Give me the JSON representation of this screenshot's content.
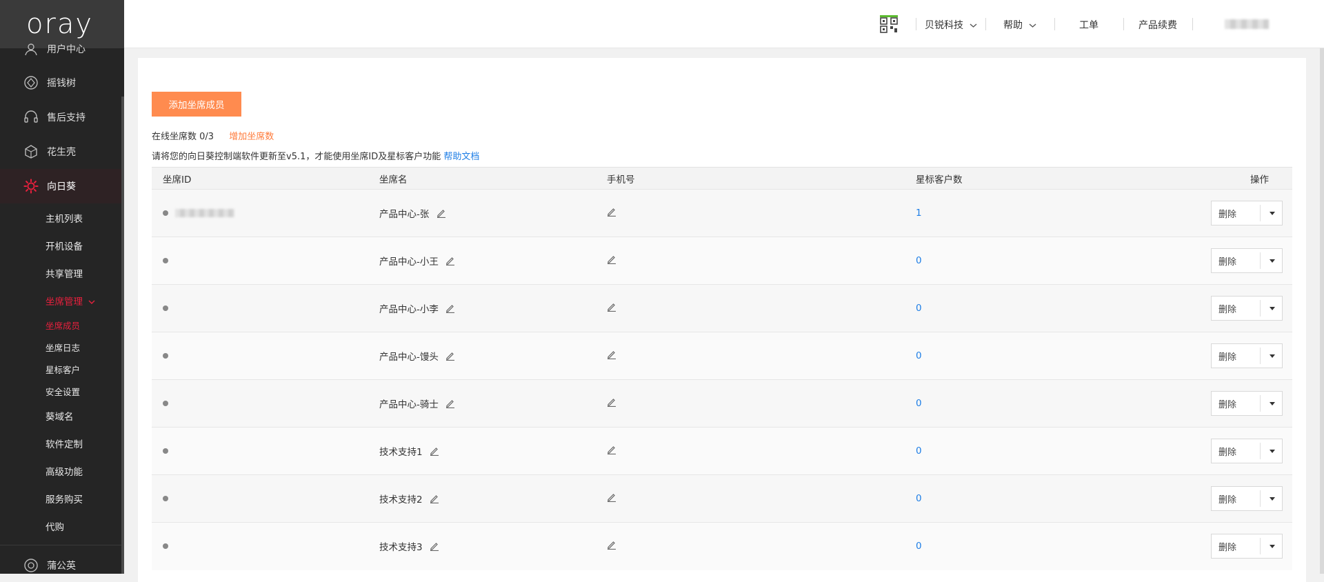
{
  "sidebar": {
    "logo": "oray",
    "main_items": [
      {
        "label": "用户中心",
        "icon": "user-icon"
      },
      {
        "label": "摇钱树",
        "icon": "money-tree-icon"
      },
      {
        "label": "售后支持",
        "icon": "headset-icon"
      },
      {
        "label": "花生壳",
        "icon": "peanut-shell-icon"
      },
      {
        "label": "向日葵",
        "icon": "sunflower-icon"
      }
    ],
    "sub_items": [
      "主机列表",
      "开机设备",
      "共享管理",
      "坐席管理",
      "坐席成员",
      "坐席日志",
      "星标客户",
      "安全设置",
      "葵域名",
      "软件定制",
      "高级功能",
      "服务购买",
      "代购"
    ],
    "bottom_item": {
      "label": "蒲公英",
      "icon": "dandelion-icon"
    }
  },
  "topbar": {
    "company": "贝锐科技",
    "help": "帮助",
    "ticket": "工单",
    "renew": "产品续费"
  },
  "main": {
    "add_button": "添加坐席成员",
    "seat_count_label": "在线坐席数 0/3",
    "add_seats_link": "增加坐席数",
    "notice": "请将您的向日葵控制端软件更新至v5.1，才能使用坐席ID及星标客户功能",
    "help_doc": "帮助文档",
    "columns": [
      "坐席ID",
      "坐席名",
      "手机号",
      "星标客户数",
      "操作"
    ],
    "rows": [
      {
        "name": "产品中心-张",
        "starred": "1",
        "action": "删除"
      },
      {
        "name": "产品中心-小王",
        "starred": "0",
        "action": "删除"
      },
      {
        "name": "产品中心-小李",
        "starred": "0",
        "action": "删除"
      },
      {
        "name": "产品中心-馒头",
        "starred": "0",
        "action": "删除"
      },
      {
        "name": "产品中心-骑士",
        "starred": "0",
        "action": "删除"
      },
      {
        "name": "技术支持1",
        "starred": "0",
        "action": "删除"
      },
      {
        "name": "技术支持2",
        "starred": "0",
        "action": "删除"
      },
      {
        "name": "技术支持3",
        "starred": "0",
        "action": "删除"
      }
    ]
  },
  "colors": {
    "accent_orange": "#ff8b4f",
    "active_red": "#e8203d",
    "link_blue": "#1e7ee6"
  }
}
